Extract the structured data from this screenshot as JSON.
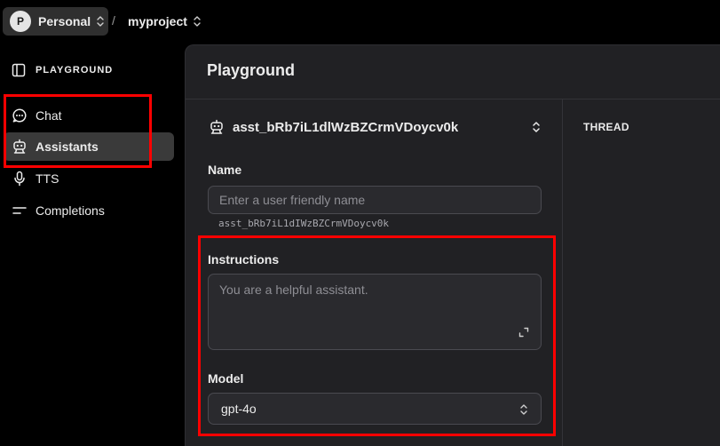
{
  "topbar": {
    "org_initial": "P",
    "org_name": "Personal",
    "separator": "/",
    "project_name": "myproject"
  },
  "sidebar": {
    "title": "PLAYGROUND",
    "items": [
      {
        "label": "Chat",
        "icon": "chat-bubble-icon",
        "active": false
      },
      {
        "label": "Assistants",
        "icon": "robot-icon",
        "active": true
      },
      {
        "label": "TTS",
        "icon": "microphone-icon",
        "active": false
      },
      {
        "label": "Completions",
        "icon": "lines-icon",
        "active": false
      }
    ]
  },
  "main": {
    "title": "Playground",
    "assistant_id": "asst_bRb7iL1dlWzBZCrmVDoycv0k",
    "name_label": "Name",
    "name_placeholder": "Enter a user friendly name",
    "name_value": "",
    "assistant_id_mono": "asst_bRb7iL1dIWzBZCrmVDoycv0k",
    "instructions_label": "Instructions",
    "instructions_placeholder": "You are a helpful assistant.",
    "model_label": "Model",
    "model_value": "gpt-4o",
    "thread_label": "THREAD"
  },
  "colors": {
    "background": "#000000",
    "panel": "#212124",
    "active_nav": "#3a3a3a",
    "highlight": "#ff0000"
  }
}
